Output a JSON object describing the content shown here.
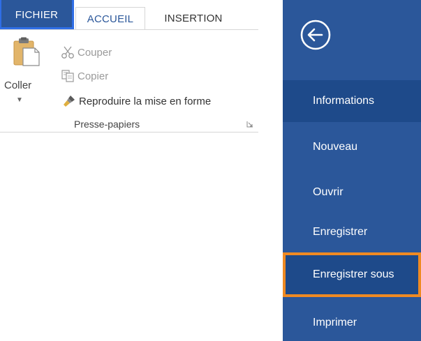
{
  "ribbon": {
    "tabs": {
      "fichier": "FICHIER",
      "accueil": "ACCUEIL",
      "insertion": "INSERTION"
    },
    "clipboard": {
      "paste_label": "Coller",
      "cut_label": "Couper",
      "copy_label": "Copier",
      "format_painter_label": "Reproduire la mise en forme",
      "group_label": "Presse-papiers"
    },
    "colors": {
      "accent": "#2b579a",
      "selection_border": "#2f6ee6",
      "disabled_text": "#9a9a9a"
    }
  },
  "backstage": {
    "items": [
      {
        "label": "Informations"
      },
      {
        "label": "Nouveau"
      },
      {
        "label": "Ouvrir"
      },
      {
        "label": "Enregistrer"
      },
      {
        "label": "Enregistrer sous"
      },
      {
        "label": "Imprimer"
      }
    ],
    "colors": {
      "background": "#2b579a",
      "active_background": "#1e4a8a",
      "highlight_border": "#ef8a23"
    },
    "icons": {
      "back": "back-arrow-icon"
    }
  }
}
